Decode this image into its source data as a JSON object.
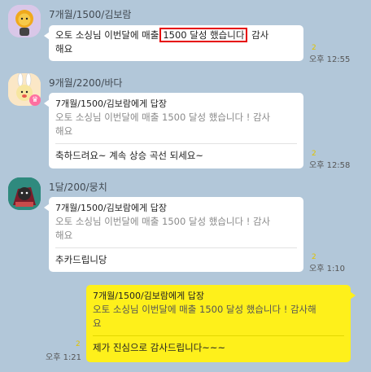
{
  "messages": [
    {
      "sender": "7개월/1500/김보람",
      "text_before": "오토 소싱님 이번달에 매출",
      "text_highlight": "1500 달성 했습니다",
      "text_after": "감사",
      "text_line2": "해요",
      "unread": "2",
      "time": "오후 12:55"
    },
    {
      "sender": "9개월/2200/바다",
      "reply_head": "7개월/1500/김보람에게 답장",
      "quote_line1": "오토 소싱님 이번달에 매출 1500 달성 했습니다 ! 감사",
      "quote_line2": "해요",
      "text": "축하드려요~ 계속 상승 곡선 되세요~",
      "unread": "2",
      "time": "오후 12:58"
    },
    {
      "sender": "1달/200/뭉치",
      "reply_head": "7개월/1500/김보람에게 답장",
      "quote_line1": "오토 소싱님 이번달에 매출 1500 달성 했습니다 ! 감사",
      "quote_line2": "해요",
      "text": "추카드립니당",
      "unread": "2",
      "time": "오후 1:10"
    },
    {
      "reply_head": "7개월/1500/김보람에게 답장",
      "quote_line1": "오토 소싱님 이번달에 매출 1500 달성 했습니다 ! 감사해",
      "quote_line2": "요",
      "text": "제가 진심으로 감사드립니다~~~",
      "unread": "2",
      "time": "오후 1:21"
    }
  ],
  "colors": {
    "background": "#b2c7d9",
    "my_bubble": "#fef01b",
    "highlight_box": "#e60000",
    "unread": "#e0c300"
  },
  "icons": [
    "avatar-ryan-icon",
    "avatar-muzi-icon",
    "avatar-jordy-icon",
    "crown-badge-icon"
  ]
}
